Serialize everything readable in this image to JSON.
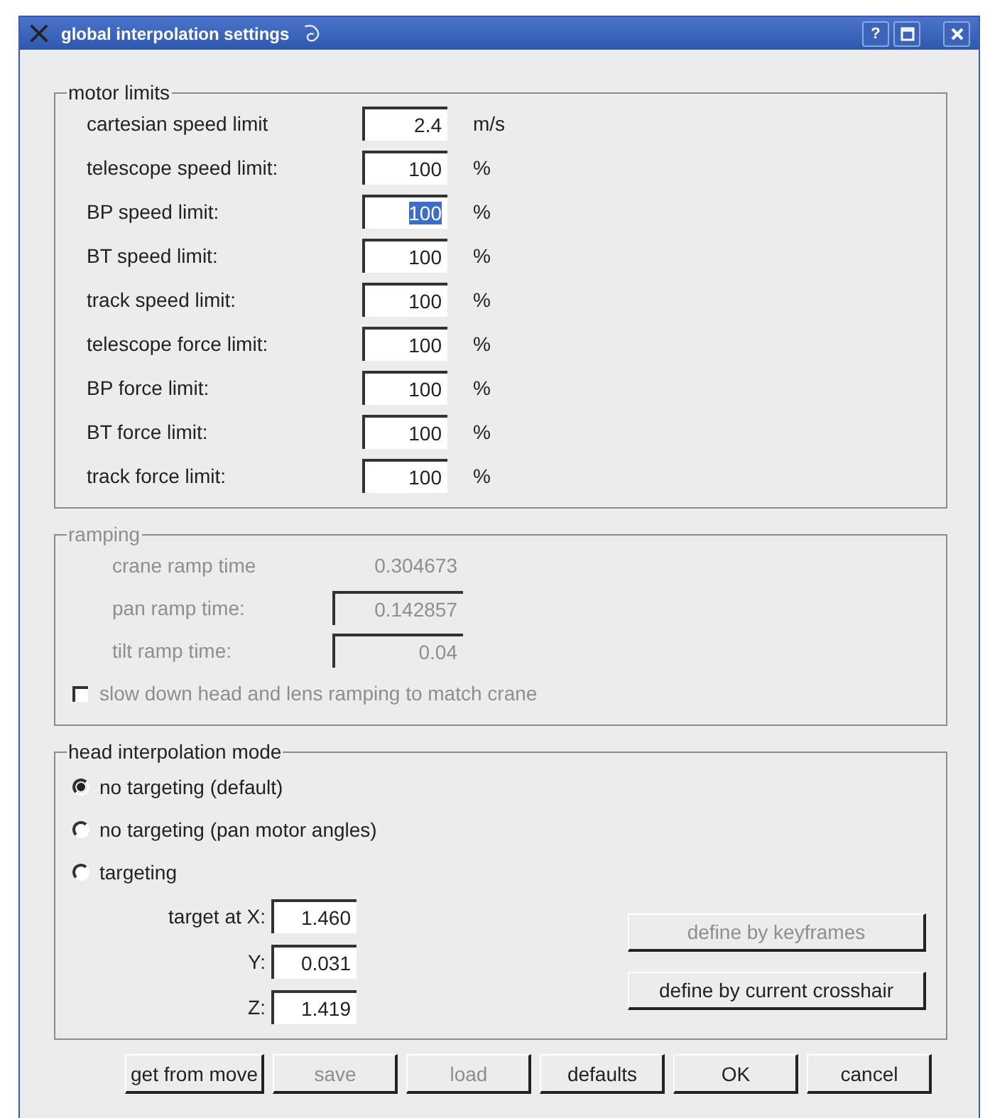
{
  "window": {
    "title": "global interpolation settings",
    "buttons": [
      {
        "kind": "help",
        "label": "?"
      },
      {
        "kind": "maximize"
      },
      {
        "kind": "close"
      }
    ]
  },
  "motor_limits": {
    "title": "motor limits",
    "rows": [
      {
        "label": "cartesian speed limit",
        "value": "2.4",
        "unit": "m/s",
        "selected": false
      },
      {
        "label": "telescope speed limit:",
        "value": "100",
        "unit": "%",
        "selected": false
      },
      {
        "label": "BP speed limit:",
        "value": "100",
        "unit": "%",
        "selected": true
      },
      {
        "label": "BT speed limit:",
        "value": "100",
        "unit": "%",
        "selected": false
      },
      {
        "label": "track speed limit:",
        "value": "100",
        "unit": "%",
        "selected": false
      },
      {
        "label": "telescope force limit:",
        "value": "100",
        "unit": "%",
        "selected": false
      },
      {
        "label": "BP force limit:",
        "value": "100",
        "unit": "%",
        "selected": false
      },
      {
        "label": "BT force limit:",
        "value": "100",
        "unit": "%",
        "selected": false
      },
      {
        "label": "track force limit:",
        "value": "100",
        "unit": "%",
        "selected": false
      }
    ]
  },
  "ramping": {
    "title": "ramping",
    "disabled": true,
    "rows": [
      {
        "kind": "text",
        "label": "crane ramp time",
        "value": "0.304673"
      },
      {
        "kind": "field",
        "label": "pan ramp time:",
        "value": "0.142857"
      },
      {
        "kind": "field",
        "label": "tilt ramp time:",
        "value": "0.04"
      }
    ],
    "checkbox": {
      "label": "slow down head and lens ramping to match crane",
      "checked": false
    }
  },
  "head_interpolation_mode": {
    "title": "head interpolation mode",
    "options": [
      {
        "label": "no targeting (default)",
        "selected": true
      },
      {
        "label": "no targeting (pan motor angles)",
        "selected": false
      },
      {
        "label": "targeting",
        "selected": false
      }
    ],
    "target": [
      {
        "label": "target at X:",
        "value": "1.460"
      },
      {
        "label": "Y:",
        "value": "0.031"
      },
      {
        "label": "Z:",
        "value": "1.419"
      }
    ],
    "buttons": [
      {
        "label": "define by keyframes",
        "disabled": true
      },
      {
        "label": "define by current crosshair",
        "disabled": false
      }
    ]
  },
  "buttons": [
    {
      "label": "get from move",
      "disabled": false
    },
    {
      "label": "save",
      "disabled": true
    },
    {
      "label": "load",
      "disabled": true
    },
    {
      "label": "defaults",
      "disabled": false
    },
    {
      "label": "OK",
      "disabled": false
    },
    {
      "label": "cancel",
      "disabled": false
    }
  ]
}
